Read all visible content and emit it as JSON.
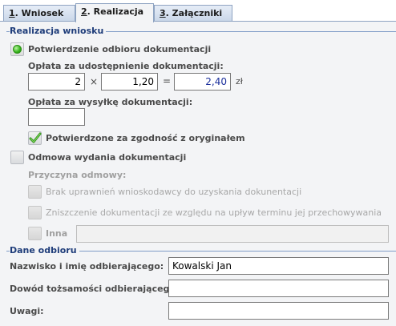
{
  "tabs": [
    {
      "key": "1",
      "rest": ". Wniosek"
    },
    {
      "key": "2",
      "rest": ". Realizacja"
    },
    {
      "key": "3",
      "rest": ". Załączniki"
    }
  ],
  "realizacja": {
    "title": "Realizacja wniosku",
    "option_confirm": "Potwierdzenie odbioru dokumentacji",
    "fee_access_label": "Opłata za udostępnienie dokumentacji:",
    "fee_qty": "2",
    "times_sign": "×",
    "fee_unit": "1,20",
    "equals_sign": "=",
    "fee_total": "2,40",
    "currency": "zł",
    "fee_shipping_label": "Opłata za wysyłkę dokumentacji:",
    "fee_shipping_value": "",
    "certified_label": "Potwierdzone za zgodność z oryginałem",
    "option_refusal": "Odmowa wydania dokumentacji",
    "refusal_reason_label": "Przyczyna odmowy:",
    "reason_1": "Brak uprawnień wnioskodawcy do uzyskania dokunentacji",
    "reason_2": "Zniszczenie dokumentacji ze względu na upływ terminu jej przechowywania",
    "reason_other": "Inna",
    "reason_other_value": ""
  },
  "odbior": {
    "title": "Dane odbioru",
    "name_label": "Nazwisko i imię odbierającego:",
    "name_value": "Kowalski Jan",
    "id_label": "Dowód tożsamości odbierającego:",
    "id_value": "",
    "notes_label": "Uwagi:",
    "notes_value": ""
  },
  "icons": {
    "radio_selected": "green-dot-icon",
    "checkmark": "green-checkmark-icon"
  },
  "colors": {
    "section_title": "#1f3d7a",
    "total_value": "#1b2f9c"
  }
}
